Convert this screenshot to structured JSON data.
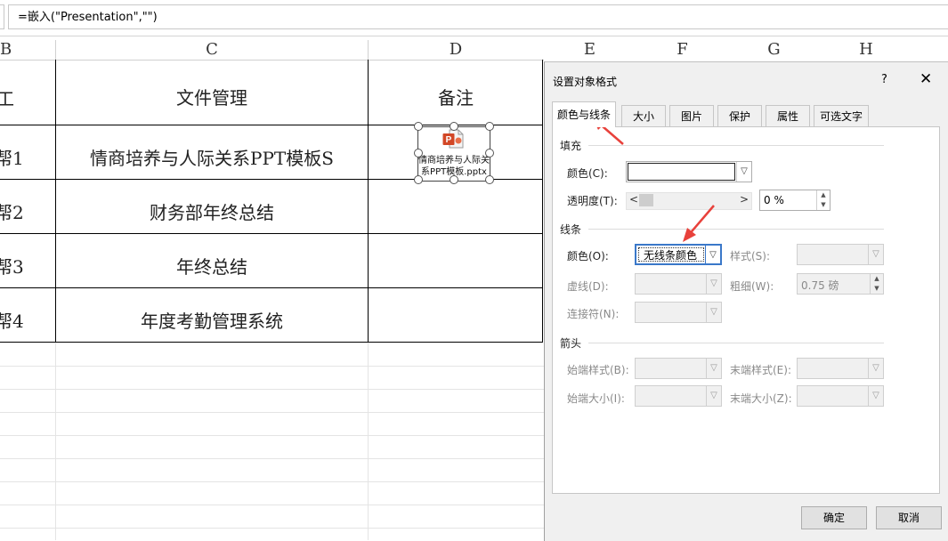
{
  "formula_bar": {
    "formula": "=嵌入(\"Presentation\",\"\")"
  },
  "columns": [
    "B",
    "C",
    "D",
    "E",
    "F",
    "G",
    "H"
  ],
  "table": {
    "header": {
      "col_b": "工",
      "col_c": "文件管理",
      "col_d": "备注"
    },
    "rows": [
      {
        "col_b": "帮1",
        "col_c": "情商培养与人际关系PPT模板S"
      },
      {
        "col_b": "帮2",
        "col_c": "财务部年终总结"
      },
      {
        "col_b": "帮3",
        "col_c": "年终总结"
      },
      {
        "col_b": "帮4",
        "col_c": "年度考勤管理系统"
      }
    ]
  },
  "embedded_object": {
    "caption_line1": "情商培养与人际关",
    "caption_line2": "系PPT模板.pptx",
    "icon": "powerpoint-icon"
  },
  "dialog": {
    "title": "设置对象格式",
    "help": "?",
    "close": "✕",
    "tabs": [
      "颜色与线条",
      "大小",
      "图片",
      "保护",
      "属性",
      "可选文字"
    ],
    "active_tab": "颜色与线条",
    "fill": {
      "section": "填充",
      "color_label": "颜色(C):",
      "color_value": "",
      "transparency_label": "透明度(T):",
      "transparency_value": "0 %",
      "transparency_left": "<",
      "transparency_right": ">"
    },
    "line": {
      "section": "线条",
      "color_label": "颜色(O):",
      "color_value": "无线条颜色",
      "dash_label": "虚线(D):",
      "connector_label": "连接符(N):",
      "style_label": "样式(S):",
      "weight_label": "粗细(W):",
      "weight_value": "0.75 磅"
    },
    "arrows": {
      "section": "箭头",
      "begin_style_label": "始端样式(B):",
      "begin_size_label": "始端大小(I):",
      "end_style_label": "末端样式(E):",
      "end_size_label": "末端大小(Z):"
    },
    "ok": "确定",
    "cancel": "取消"
  },
  "colors": {
    "annotation_red": "#e8413b",
    "border_dark": "#000000",
    "grid": "#d8d8d8"
  }
}
